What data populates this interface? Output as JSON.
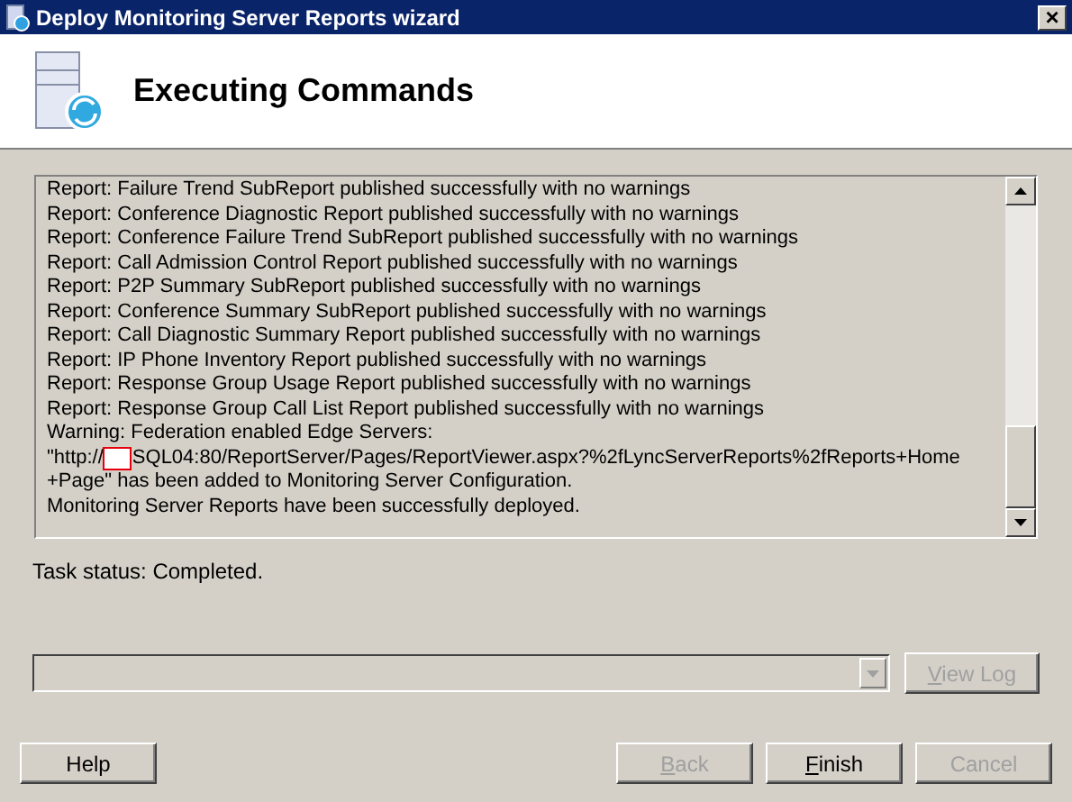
{
  "window": {
    "title": "Deploy Monitoring Server Reports wizard",
    "close": "×"
  },
  "header": {
    "title": "Executing Commands"
  },
  "log": {
    "lines": [
      {
        "kind": "text",
        "text": "Report: Failure Trend SubReport published successfully with no warnings"
      },
      {
        "kind": "text",
        "text": "Report: Conference Diagnostic Report published successfully with no warnings"
      },
      {
        "kind": "text",
        "text": "Report: Conference Failure Trend SubReport published successfully with no warnings"
      },
      {
        "kind": "text",
        "text": "Report: Call Admission Control Report published successfully with no warnings"
      },
      {
        "kind": "text",
        "text": "Report: P2P Summary SubReport published successfully with no warnings"
      },
      {
        "kind": "text",
        "text": "Report: Conference Summary SubReport published successfully with no warnings"
      },
      {
        "kind": "text",
        "text": "Report: Call Diagnostic Summary Report published successfully with no warnings"
      },
      {
        "kind": "text",
        "text": "Report: IP Phone Inventory Report published successfully with no warnings"
      },
      {
        "kind": "text",
        "text": "Report: Response Group Usage Report published successfully with no warnings"
      },
      {
        "kind": "text",
        "text": "Report: Response Group Call List Report published successfully with no warnings"
      },
      {
        "kind": "text",
        "text": "Warning: Federation enabled Edge Servers:"
      },
      {
        "kind": "redacted",
        "before": "\"http://",
        "after": "SQL04:80/ReportServer/Pages/ReportViewer.aspx?%2fLyncServerReports%2fReports+Home"
      },
      {
        "kind": "text",
        "text": "+Page\" has been added to Monitoring Server Configuration."
      },
      {
        "kind": "text",
        "text": "Monitoring Server Reports have been successfully deployed."
      }
    ]
  },
  "task_status": "Task status: Completed.",
  "combo": {
    "disabled": true
  },
  "view_log": {
    "key": "V",
    "rest": "iew Log",
    "disabled": true
  },
  "buttons": [
    {
      "kind": "help",
      "rest": "Help",
      "disabled": false
    },
    {
      "kind": "nav",
      "key": "B",
      "rest": "ack",
      "disabled": true
    },
    {
      "kind": "nav",
      "key": "F",
      "rest": "inish",
      "disabled": false
    },
    {
      "kind": "nav",
      "rest": "Cancel",
      "disabled": true
    }
  ]
}
